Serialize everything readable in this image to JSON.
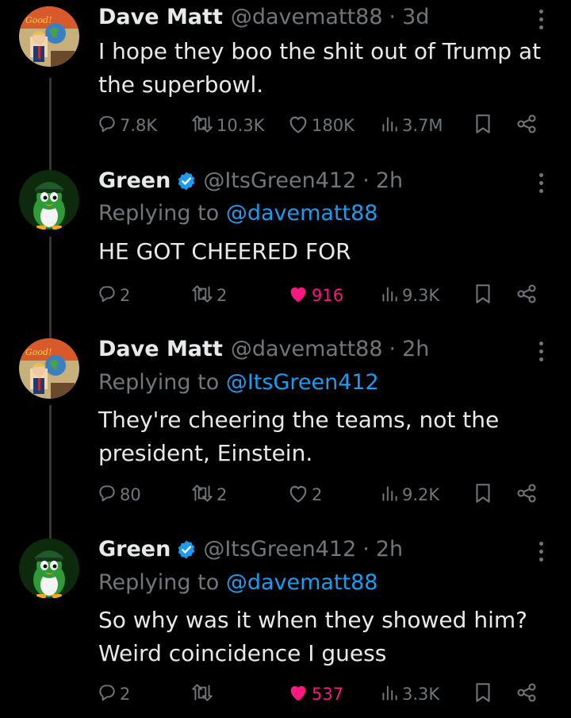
{
  "tweets": [
    {
      "author": "Dave Matt",
      "handle": "@davematt88",
      "time": "3d",
      "verified": false,
      "replying_to": null,
      "text": "I hope they boo the shit out of Trump at\nthe superbowl.",
      "stats": {
        "replies": "7.8K",
        "retweets": "10.3K",
        "likes": "180K",
        "views": "3.7M"
      },
      "liked": false
    },
    {
      "author": "Green",
      "handle": "@ItsGreen412",
      "time": "2h",
      "verified": true,
      "replying_to": {
        "prefix": "Replying to",
        "mention": "@davematt88"
      },
      "text": "HE GOT CHEERED FOR",
      "stats": {
        "replies": "2",
        "retweets": "2",
        "likes": "916",
        "views": "9.3K"
      },
      "liked": true
    },
    {
      "author": "Dave Matt",
      "handle": "@davematt88",
      "time": "2h",
      "verified": false,
      "replying_to": {
        "prefix": "Replying to",
        "mention": "@ItsGreen412"
      },
      "text": "They're cheering the teams, not the\npresident, Einstein.",
      "stats": {
        "replies": "80",
        "retweets": "2",
        "likes": "2",
        "views": "9.2K"
      },
      "liked": false
    },
    {
      "author": "Green",
      "handle": "@ItsGreen412",
      "time": "2h",
      "verified": true,
      "replying_to": {
        "prefix": "Replying to",
        "mention": "@davematt88"
      },
      "text": "So why was it when they showed him?\nWeird coincidence I guess",
      "stats": {
        "replies": "2",
        "retweets": "",
        "likes": "537",
        "views": "3.3K"
      },
      "liked": true
    }
  ],
  "separator": "·",
  "icons": {
    "reply": "reply-icon",
    "retweet": "retweet-icon",
    "like": "heart-icon",
    "views": "views-icon",
    "bookmark": "bookmark-icon",
    "share": "share-icon",
    "more": "more-options-icon",
    "verified": "verified-badge-icon"
  },
  "colors": {
    "background": "#000000",
    "text": "#e7e9ea",
    "muted": "#71767b",
    "link": "#1d9bf0",
    "like_active": "#f91880",
    "verified_badge": "#1d9bf0",
    "thread_line": "#333639"
  }
}
